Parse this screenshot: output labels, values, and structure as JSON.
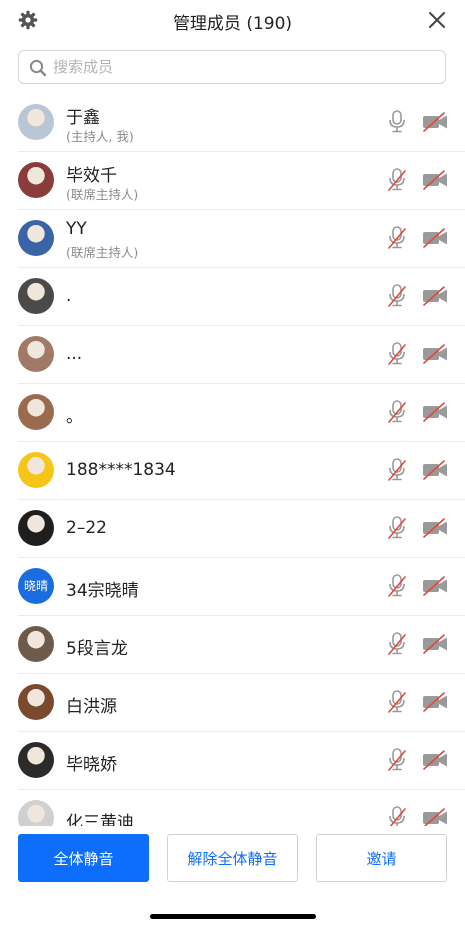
{
  "header": {
    "title": "管理成员 (190)",
    "settings_icon": "gear-icon",
    "close_icon": "close-icon"
  },
  "search": {
    "placeholder": "搜索成员",
    "value": ""
  },
  "colors": {
    "accent": "#0d6efd",
    "muted_red": "#e04a3a"
  },
  "members": [
    {
      "name": "于鑫",
      "role": "(主持人, 我)",
      "avatar": "photo",
      "avatar_color": "#b9c6d6",
      "mic_muted": false,
      "cam_off": true
    },
    {
      "name": "毕效千",
      "role": "(联席主持人)",
      "avatar": "photo",
      "avatar_color": "#8a3b3b",
      "mic_muted": true,
      "cam_off": true
    },
    {
      "name": "YY",
      "role": "(联席主持人)",
      "avatar": "photo",
      "avatar_color": "#3a63a8",
      "mic_muted": true,
      "cam_off": true
    },
    {
      "name": ".",
      "role": "",
      "avatar": "photo",
      "avatar_color": "#4a4a4a",
      "mic_muted": true,
      "cam_off": true
    },
    {
      "name": "...",
      "role": "",
      "avatar": "photo",
      "avatar_color": "#a07a66",
      "mic_muted": true,
      "cam_off": true
    },
    {
      "name": "。",
      "role": "",
      "avatar": "photo",
      "avatar_color": "#9a6b4f",
      "mic_muted": true,
      "cam_off": true
    },
    {
      "name": "188****1834",
      "role": "",
      "avatar": "photo",
      "avatar_color": "#f5c518",
      "mic_muted": true,
      "cam_off": true
    },
    {
      "name": "2–22",
      "role": "",
      "avatar": "photo",
      "avatar_color": "#1e1e1e",
      "mic_muted": true,
      "cam_off": true
    },
    {
      "name": "34宗晓晴",
      "role": "",
      "avatar": "text",
      "avatar_text": "晓晴",
      "avatar_color": "#1a6de0",
      "mic_muted": true,
      "cam_off": true
    },
    {
      "name": "5段言龙",
      "role": "",
      "avatar": "photo",
      "avatar_color": "#6d5a4a",
      "mic_muted": true,
      "cam_off": true
    },
    {
      "name": "白洪源",
      "role": "",
      "avatar": "photo",
      "avatar_color": "#7a4a2f",
      "mic_muted": true,
      "cam_off": true
    },
    {
      "name": "毕晓娇",
      "role": "",
      "avatar": "photo",
      "avatar_color": "#2b2b2b",
      "mic_muted": true,
      "cam_off": true
    },
    {
      "name": "化三黄迪",
      "role": "",
      "avatar": "photo",
      "avatar_color": "#d0d0d0",
      "mic_muted": true,
      "cam_off": true
    }
  ],
  "actions": {
    "mute_all": "全体静音",
    "unmute_all": "解除全体静音",
    "invite": "邀请"
  }
}
